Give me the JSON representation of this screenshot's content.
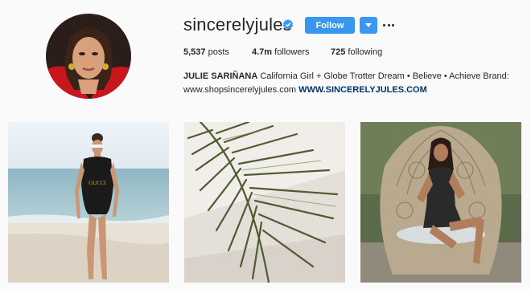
{
  "profile": {
    "username": "sincerelyjules",
    "verified": true,
    "follow_label": "Follow",
    "stats": {
      "posts_count": "5,537",
      "posts_label": "posts",
      "followers_count": "4.7m",
      "followers_label": "followers",
      "following_count": "725",
      "following_label": "following"
    },
    "bio": {
      "name": "JULIE SARIÑANA",
      "text_line1": "California Girl + Globe Trotter Dream • Believe • Achieve Brand:",
      "website_plain": "www.shopsincerelyjules.com",
      "website_bold": "WWW.SINCERELYJULES.COM"
    }
  },
  "icons": {
    "verified": "verified-badge-icon",
    "dropdown": "chevron-down-icon",
    "more": "more-options-icon"
  },
  "colors": {
    "accent": "#3897f0",
    "background": "#fafafa",
    "text": "#262626",
    "link": "#003569"
  },
  "posts": [
    {
      "subject": "woman in black swimsuit on beach"
    },
    {
      "subject": "palm leaf shadow on white wall"
    },
    {
      "subject": "woman seated in wicker peacock chair"
    }
  ]
}
